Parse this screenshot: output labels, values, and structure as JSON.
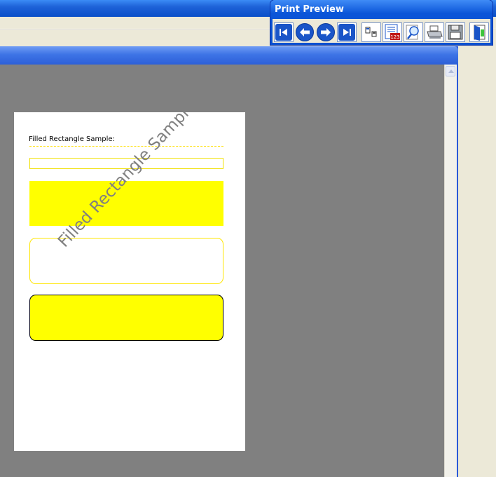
{
  "print_preview": {
    "title": "Print Preview",
    "buttons": [
      {
        "name": "first-page",
        "icon": "first-page-icon"
      },
      {
        "name": "previous-page",
        "icon": "arrow-left-icon"
      },
      {
        "name": "next-page",
        "icon": "arrow-right-icon"
      },
      {
        "name": "last-page",
        "icon": "last-page-icon"
      },
      {
        "name": "page-setup",
        "icon": "page-layout-icon"
      },
      {
        "name": "page-number",
        "icon": "page-number-icon"
      },
      {
        "name": "zoom",
        "icon": "magnifier-icon"
      },
      {
        "name": "print",
        "icon": "printer-icon"
      },
      {
        "name": "save",
        "icon": "floppy-disk-icon"
      },
      {
        "name": "close",
        "icon": "exit-door-icon"
      }
    ]
  },
  "page": {
    "heading": "Filled Rectangle Sample:",
    "watermark": "Filled Rectangle Sample:",
    "badge_text": "123"
  },
  "colors": {
    "shape_fill": "#ffff00",
    "preview_background": "#808080",
    "titlebar_blue": "#0a4fcf"
  }
}
